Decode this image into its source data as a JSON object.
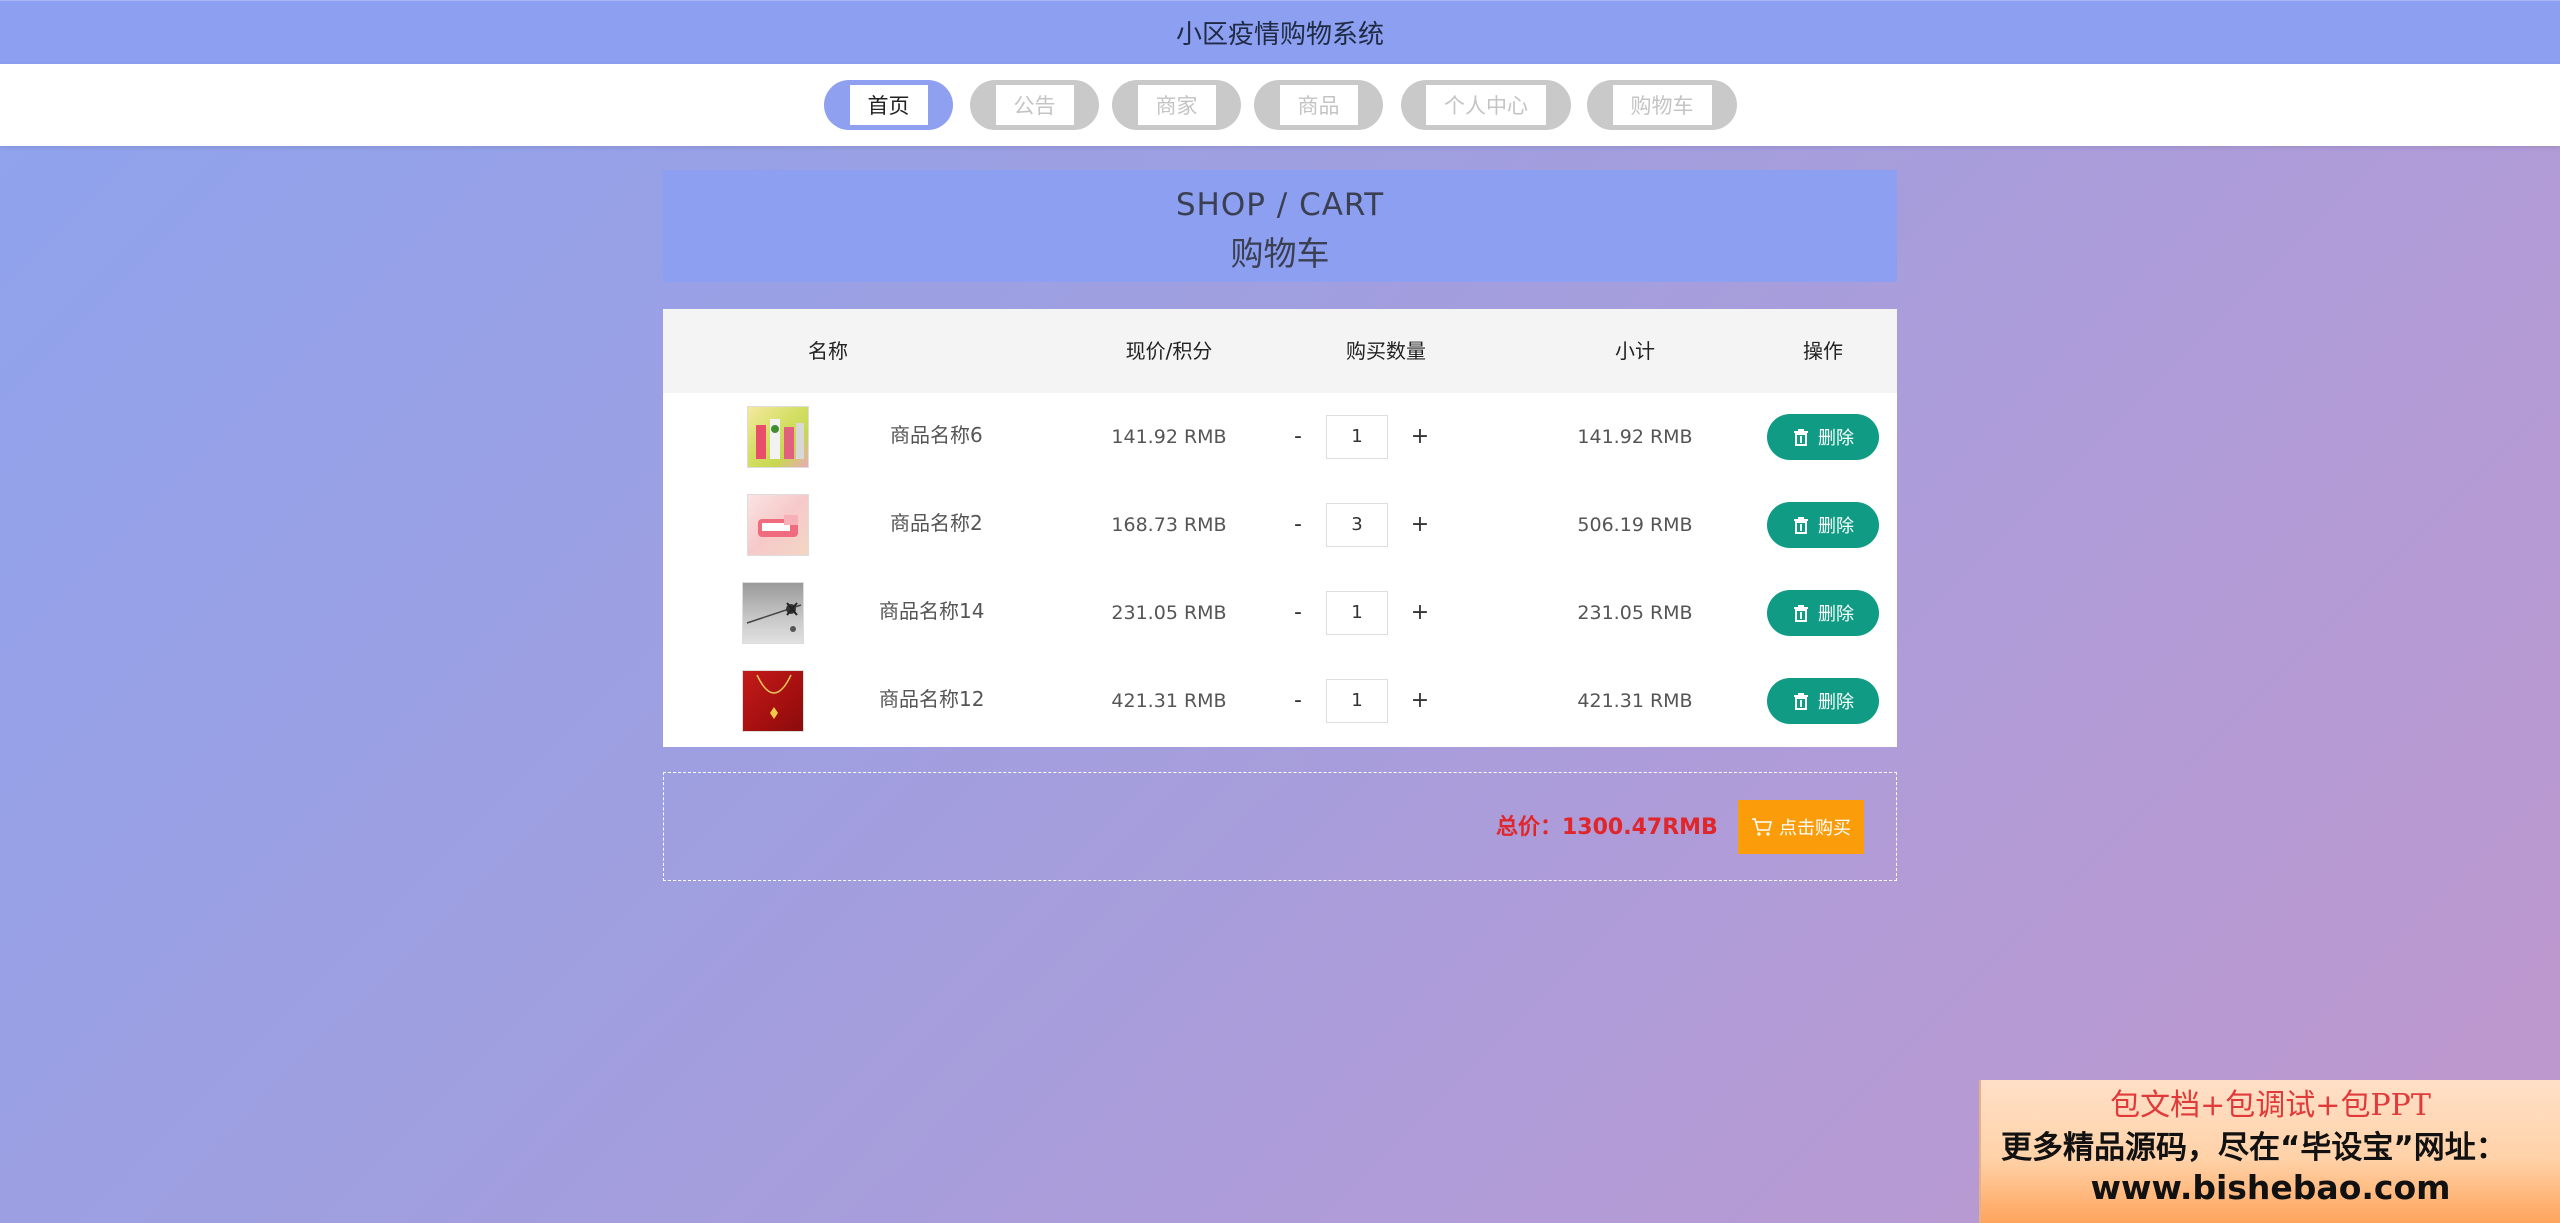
{
  "app": {
    "title": "小区疫情购物系统"
  },
  "nav": [
    {
      "label": "首页",
      "active": true
    },
    {
      "label": "公告",
      "active": false
    },
    {
      "label": "商家",
      "active": false
    },
    {
      "label": "商品",
      "active": false
    },
    {
      "label": "个人中心",
      "active": false
    },
    {
      "label": "购物车",
      "active": false
    }
  ],
  "hero": {
    "en": "SHOP / CART",
    "zh": "购物车"
  },
  "cart": {
    "headers": {
      "name": "名称",
      "price": "现价/积分",
      "qty": "购买数量",
      "subtotal": "小计",
      "action": "操作"
    },
    "items": [
      {
        "name": "商品名称6",
        "price": "141.92 RMB",
        "qty": "1",
        "subtotal": "141.92 RMB",
        "delete_label": "删除"
      },
      {
        "name": "商品名称2",
        "price": "168.73 RMB",
        "qty": "3",
        "subtotal": "506.19 RMB",
        "delete_label": "删除"
      },
      {
        "name": "商品名称14",
        "price": "231.05 RMB",
        "qty": "1",
        "subtotal": "231.05 RMB",
        "delete_label": "删除"
      },
      {
        "name": "商品名称12",
        "price": "421.31 RMB",
        "qty": "1",
        "subtotal": "421.31 RMB",
        "delete_label": "删除"
      }
    ],
    "minus_label": "-",
    "plus_label": "+"
  },
  "checkout": {
    "total_text": "总价：1300.47RMB",
    "buy_label": "点击购买"
  },
  "promo": {
    "line1": "包文档+包调试+包PPT",
    "line2": "更多精品源码，尽在“毕设宝”网址：",
    "line3": "www.bishebao.com"
  },
  "colors": {
    "accent": "#8c9ff0",
    "delete": "#109c84",
    "buy": "#fb9c0a",
    "total": "#e0262b"
  }
}
